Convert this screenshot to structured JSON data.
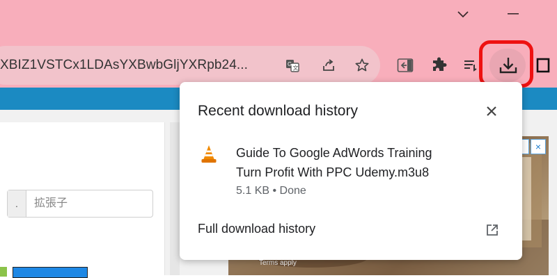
{
  "window": {
    "controls": {
      "minimize_icon": "chevron-down-icon",
      "close_icon": "minimize-icon"
    }
  },
  "toolbar": {
    "url": "XBIZ1VSTCx1LDAsYXBwbGljYXRpb24...",
    "icons": [
      "translate-icon",
      "share-icon",
      "star-icon",
      "sidebar-icon",
      "extensions-icon",
      "reading-list-icon",
      "download-icon",
      "profile-icon"
    ]
  },
  "page": {
    "input_addon": ".",
    "input_placeholder": "拡張子",
    "ad_badge": {
      "info": "i",
      "close": "×"
    },
    "ad_terms": "Terms apply"
  },
  "download_popup": {
    "title": "Recent download history",
    "item": {
      "name_line1": "Guide To Google AdWords Training",
      "name_line2": "Turn Profit With PPC  Udemy.m3u8",
      "status": "5.1 KB • Done",
      "icon": "vlc-cone-icon"
    },
    "full_history_label": "Full download history"
  },
  "colors": {
    "titlebar": "#f8aebb",
    "omnibox": "#f2c3cb",
    "accent_bar": "#1b8ac2",
    "highlight": "#ee1111"
  }
}
